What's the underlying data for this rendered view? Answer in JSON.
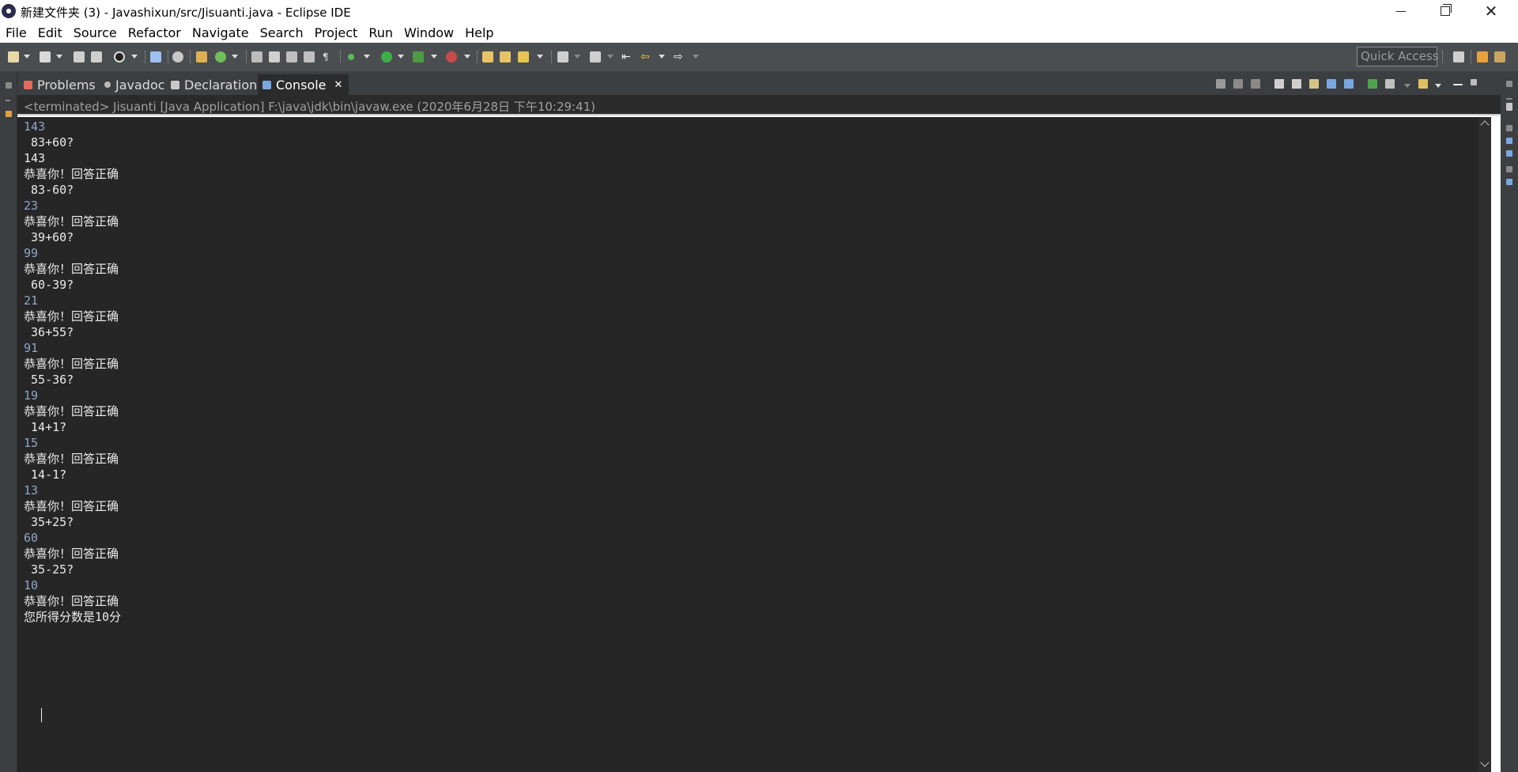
{
  "window": {
    "title": "新建文件夹 (3) - Javashixun/src/Jisuanti.java - Eclipse IDE"
  },
  "menu": [
    "File",
    "Edit",
    "Source",
    "Refactor",
    "Navigate",
    "Search",
    "Project",
    "Run",
    "Window",
    "Help"
  ],
  "toolbar": {
    "quick_access": "Quick Access"
  },
  "tabs": [
    {
      "label": "Problems",
      "icon": "problems-icon",
      "color": "#e06c5b"
    },
    {
      "label": "Javadoc",
      "icon": "javadoc-icon",
      "color": "#bbbbbb"
    },
    {
      "label": "Declaration",
      "icon": "declaration-icon",
      "color": "#c9c9c9"
    },
    {
      "label": "Console",
      "icon": "console-icon",
      "color": "#7aa7e0",
      "active": true,
      "close": "✕"
    }
  ],
  "console": {
    "terminated_line": "<terminated> Jisuanti [Java Application] F:\\java\\jdk\\bin\\javaw.exe (2020年6月28日 下午10:29:41)",
    "lines": [
      {
        "text": "143",
        "kind": "in"
      },
      {
        "text": " 83+60?",
        "kind": "out"
      },
      {
        "text": "143",
        "kind": "out"
      },
      {
        "text": "恭喜你！回答正确",
        "kind": "out"
      },
      {
        "text": " 83-60?",
        "kind": "out"
      },
      {
        "text": "23",
        "kind": "in"
      },
      {
        "text": "恭喜你！回答正确",
        "kind": "out"
      },
      {
        "text": " 39+60?",
        "kind": "out"
      },
      {
        "text": "99",
        "kind": "in"
      },
      {
        "text": "恭喜你！回答正确",
        "kind": "out"
      },
      {
        "text": " 60-39?",
        "kind": "out"
      },
      {
        "text": "21",
        "kind": "in"
      },
      {
        "text": "恭喜你！回答正确",
        "kind": "out"
      },
      {
        "text": " 36+55?",
        "kind": "out"
      },
      {
        "text": "91",
        "kind": "in"
      },
      {
        "text": "恭喜你！回答正确",
        "kind": "out"
      },
      {
        "text": " 55-36?",
        "kind": "out"
      },
      {
        "text": "19",
        "kind": "in"
      },
      {
        "text": "恭喜你！回答正确",
        "kind": "out"
      },
      {
        "text": " 14+1?",
        "kind": "out"
      },
      {
        "text": "15",
        "kind": "in"
      },
      {
        "text": "恭喜你！回答正确",
        "kind": "out"
      },
      {
        "text": " 14-1?",
        "kind": "out"
      },
      {
        "text": "13",
        "kind": "in"
      },
      {
        "text": "恭喜你！回答正确",
        "kind": "out"
      },
      {
        "text": " 35+25?",
        "kind": "out"
      },
      {
        "text": "60",
        "kind": "in"
      },
      {
        "text": "恭喜你！回答正确",
        "kind": "out"
      },
      {
        "text": " 35-25?",
        "kind": "out"
      },
      {
        "text": "10",
        "kind": "in"
      },
      {
        "text": "恭喜你！回答正确",
        "kind": "out"
      },
      {
        "text": "您所得分数是10分",
        "kind": "out"
      }
    ]
  },
  "colors": {
    "console_bg": "#262626",
    "input_text": "#8ea7c7",
    "output_text": "#ebebeb",
    "toolbar_bg": "#4a4e51"
  }
}
